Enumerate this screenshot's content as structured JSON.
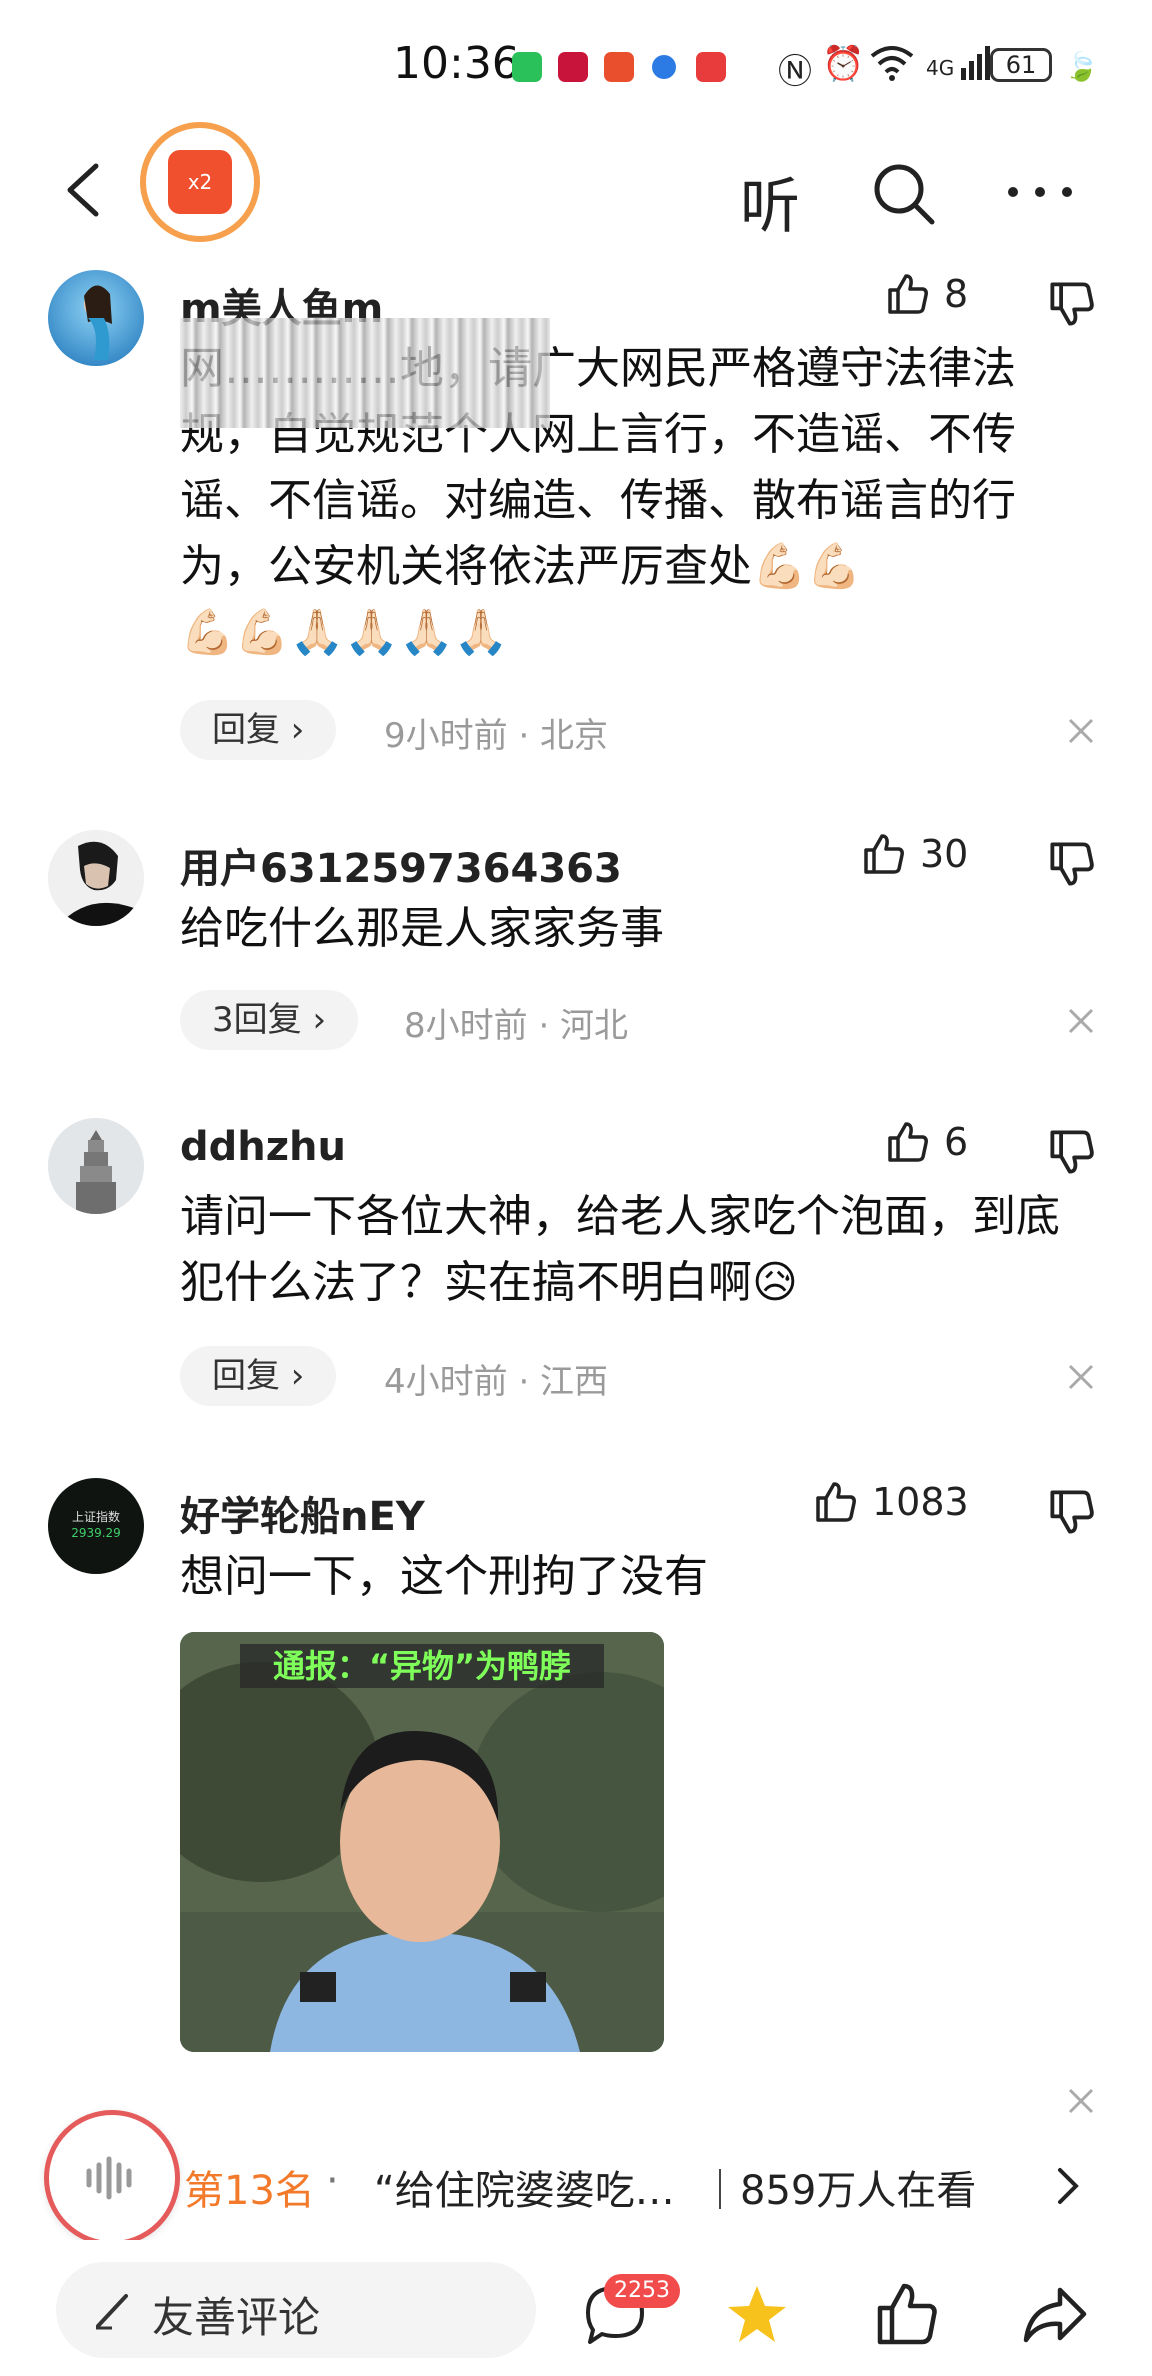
{
  "status_bar": {
    "time": "10:36",
    "signal": "4G",
    "battery": "61"
  },
  "nav": {
    "listen_label": "听",
    "redpack_label": "x2"
  },
  "comments": [
    {
      "username": "m美人鱼m",
      "likes": "8",
      "text": "网…………地，请广大网民严格遵守法律法规，自觉规范个人网上言行，不造谣、不传谣、不信谣。对编造、传播、散布谣言的行为，公安机关将依法严厉查处💪🏻💪🏻",
      "text_line2": "💪🏻💪🏻🙏🏻🙏🏻🙏🏻🙏🏻",
      "reply_label": "回复 ›",
      "meta": "9小时前 · 北京"
    },
    {
      "username": "用户6312597364363",
      "likes": "30",
      "text": "给吃什么那是人家家务事",
      "reply_label": "3回复 ›",
      "meta": "8小时前 · 河北"
    },
    {
      "username": "ddhzhu",
      "likes": "6",
      "text": "请问一下各位大神，给老人家吃个泡面，到底犯什么法了？实在搞不明白啊😥",
      "reply_label": "回复 ›",
      "meta": "4小时前 · 江西"
    },
    {
      "username": "好学轮船nEY",
      "likes": "1083",
      "text": "想问一下，这个刑拘了没有",
      "image_caption": "通报：“异物”为鸭脖",
      "avatar_caption_1": "上证指数",
      "avatar_caption_2": "2939.29"
    }
  ],
  "hot_bar": {
    "rank": "第13名",
    "separator": "·",
    "title": "“给住院婆婆吃…",
    "viewers": "｜859万人在看"
  },
  "bottom_bar": {
    "comment_placeholder": "友善评论",
    "comment_count": "2253"
  }
}
